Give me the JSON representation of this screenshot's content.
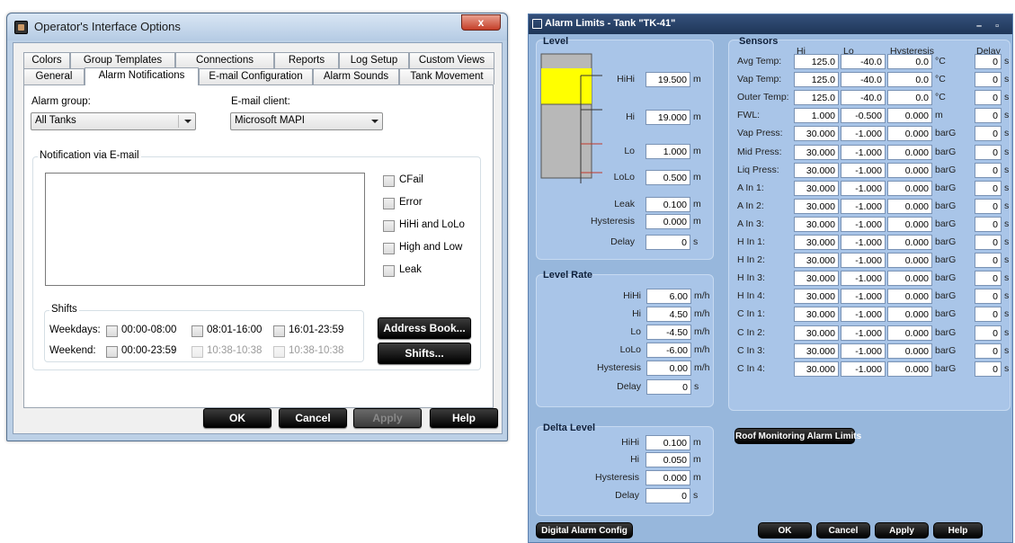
{
  "dialog": {
    "title": "Operator's Interface Options",
    "close": "x",
    "tabs_row1": [
      "Colors",
      "Group Templates",
      "Connections",
      "Reports",
      "Log Setup",
      "Custom Views"
    ],
    "tabs_row2": [
      "General",
      "Alarm Notifications",
      "E-mail Configuration",
      "Alarm Sounds",
      "Tank Movement"
    ],
    "selected_tab": "Alarm Notifications",
    "alarm_group_label": "Alarm group:",
    "alarm_group_value": "All Tanks",
    "email_client_label": "E-mail client:",
    "email_client_value": "Microsoft MAPI",
    "notification_group": "Notification via E-mail",
    "checks": {
      "cfail": "CFail",
      "error": "Error",
      "hihi_lolo": "HiHi and LoLo",
      "high_low": "High and Low",
      "leak": "Leak"
    },
    "shifts_group": "Shifts",
    "weekdays_label": "Weekdays:",
    "weekend_label": "Weekend:",
    "weekday_shifts": [
      "00:00-08:00",
      "08:01-16:00",
      "16:01-23:59"
    ],
    "weekend_shifts": [
      "00:00-23:59",
      "10:38-10:38",
      "10:38-10:38"
    ],
    "address_book": "Address Book...",
    "shifts_button": "Shifts...",
    "buttons": {
      "ok": "OK",
      "cancel": "Cancel",
      "apply": "Apply",
      "help": "Help"
    }
  },
  "window": {
    "title": "Alarm Limits - Tank \"TK-41\"",
    "controls": "– ▫",
    "level": {
      "title": "Level",
      "rows": [
        {
          "label": "HiHi",
          "value": "19.500",
          "unit": "m"
        },
        {
          "label": "Hi",
          "value": "19.000",
          "unit": "m"
        },
        {
          "label": "Lo",
          "value": "1.000",
          "unit": "m"
        },
        {
          "label": "LoLo",
          "value": "0.500",
          "unit": "m"
        },
        {
          "label": "Leak",
          "value": "0.100",
          "unit": "m"
        },
        {
          "label": "Hysteresis",
          "value": "0.000",
          "unit": "m"
        },
        {
          "label": "Delay",
          "value": "0",
          "unit": "s"
        }
      ],
      "fill_fraction": 0.72
    },
    "level_rate": {
      "title": "Level Rate",
      "rows": [
        {
          "label": "HiHi",
          "value": "6.00",
          "unit": "m/h"
        },
        {
          "label": "Hi",
          "value": "4.50",
          "unit": "m/h"
        },
        {
          "label": "Lo",
          "value": "-4.50",
          "unit": "m/h"
        },
        {
          "label": "LoLo",
          "value": "-6.00",
          "unit": "m/h"
        },
        {
          "label": "Hysteresis",
          "value": "0.00",
          "unit": "m/h"
        },
        {
          "label": "Delay",
          "value": "0",
          "unit": "s"
        }
      ]
    },
    "delta_level": {
      "title": "Delta Level",
      "rows": [
        {
          "label": "HiHi",
          "value": "0.100",
          "unit": "m"
        },
        {
          "label": "Hi",
          "value": "0.050",
          "unit": "m"
        },
        {
          "label": "Hysteresis",
          "value": "0.000",
          "unit": "m"
        },
        {
          "label": "Delay",
          "value": "0",
          "unit": "s"
        }
      ]
    },
    "sensors": {
      "title": "Sensors",
      "headers": [
        "Hi",
        "Lo",
        "Hysteresis",
        "Delay"
      ],
      "rows": [
        {
          "label": "Avg Temp:",
          "hi": "125.0",
          "lo": "-40.0",
          "hys": "0.0",
          "unit": "°C",
          "delay": "0"
        },
        {
          "label": "Vap Temp:",
          "hi": "125.0",
          "lo": "-40.0",
          "hys": "0.0",
          "unit": "°C",
          "delay": "0"
        },
        {
          "label": "Outer Temp:",
          "hi": "125.0",
          "lo": "-40.0",
          "hys": "0.0",
          "unit": "°C",
          "delay": "0"
        },
        {
          "label": "FWL:",
          "hi": "1.000",
          "lo": "-0.500",
          "hys": "0.000",
          "unit": "m",
          "delay": "0"
        },
        {
          "label": "Vap Press:",
          "hi": "30.000",
          "lo": "-1.000",
          "hys": "0.000",
          "unit": "barG",
          "delay": "0"
        },
        {
          "label": "Mid Press:",
          "hi": "30.000",
          "lo": "-1.000",
          "hys": "0.000",
          "unit": "barG",
          "delay": "0"
        },
        {
          "label": "Liq Press:",
          "hi": "30.000",
          "lo": "-1.000",
          "hys": "0.000",
          "unit": "barG",
          "delay": "0"
        },
        {
          "label": "A In 1:",
          "hi": "30.000",
          "lo": "-1.000",
          "hys": "0.000",
          "unit": "barG",
          "delay": "0"
        },
        {
          "label": "A In 2:",
          "hi": "30.000",
          "lo": "-1.000",
          "hys": "0.000",
          "unit": "barG",
          "delay": "0"
        },
        {
          "label": "A In 3:",
          "hi": "30.000",
          "lo": "-1.000",
          "hys": "0.000",
          "unit": "barG",
          "delay": "0"
        },
        {
          "label": "H In 1:",
          "hi": "30.000",
          "lo": "-1.000",
          "hys": "0.000",
          "unit": "barG",
          "delay": "0"
        },
        {
          "label": "H In 2:",
          "hi": "30.000",
          "lo": "-1.000",
          "hys": "0.000",
          "unit": "barG",
          "delay": "0"
        },
        {
          "label": "H In 3:",
          "hi": "30.000",
          "lo": "-1.000",
          "hys": "0.000",
          "unit": "barG",
          "delay": "0"
        },
        {
          "label": "H In 4:",
          "hi": "30.000",
          "lo": "-1.000",
          "hys": "0.000",
          "unit": "barG",
          "delay": "0"
        },
        {
          "label": "C In 1:",
          "hi": "30.000",
          "lo": "-1.000",
          "hys": "0.000",
          "unit": "barG",
          "delay": "0"
        },
        {
          "label": "C In 2:",
          "hi": "30.000",
          "lo": "-1.000",
          "hys": "0.000",
          "unit": "barG",
          "delay": "0"
        },
        {
          "label": "C In 3:",
          "hi": "30.000",
          "lo": "-1.000",
          "hys": "0.000",
          "unit": "barG",
          "delay": "0"
        },
        {
          "label": "C In 4:",
          "hi": "30.000",
          "lo": "-1.000",
          "hys": "0.000",
          "unit": "barG",
          "delay": "0"
        }
      ],
      "delay_unit": "s"
    },
    "roof_button": "Roof Monitoring Alarm Limits",
    "digital_button": "Digital Alarm Config",
    "buttons": {
      "ok": "OK",
      "cancel": "Cancel",
      "apply": "Apply",
      "help": "Help"
    }
  },
  "colors": {
    "dialog_frame": "#bcd0e6",
    "window_bg": "#97b7dc",
    "panel": "#a9c5e8",
    "tank_fill": "#ffff00",
    "title_bar": "#1f3658"
  }
}
